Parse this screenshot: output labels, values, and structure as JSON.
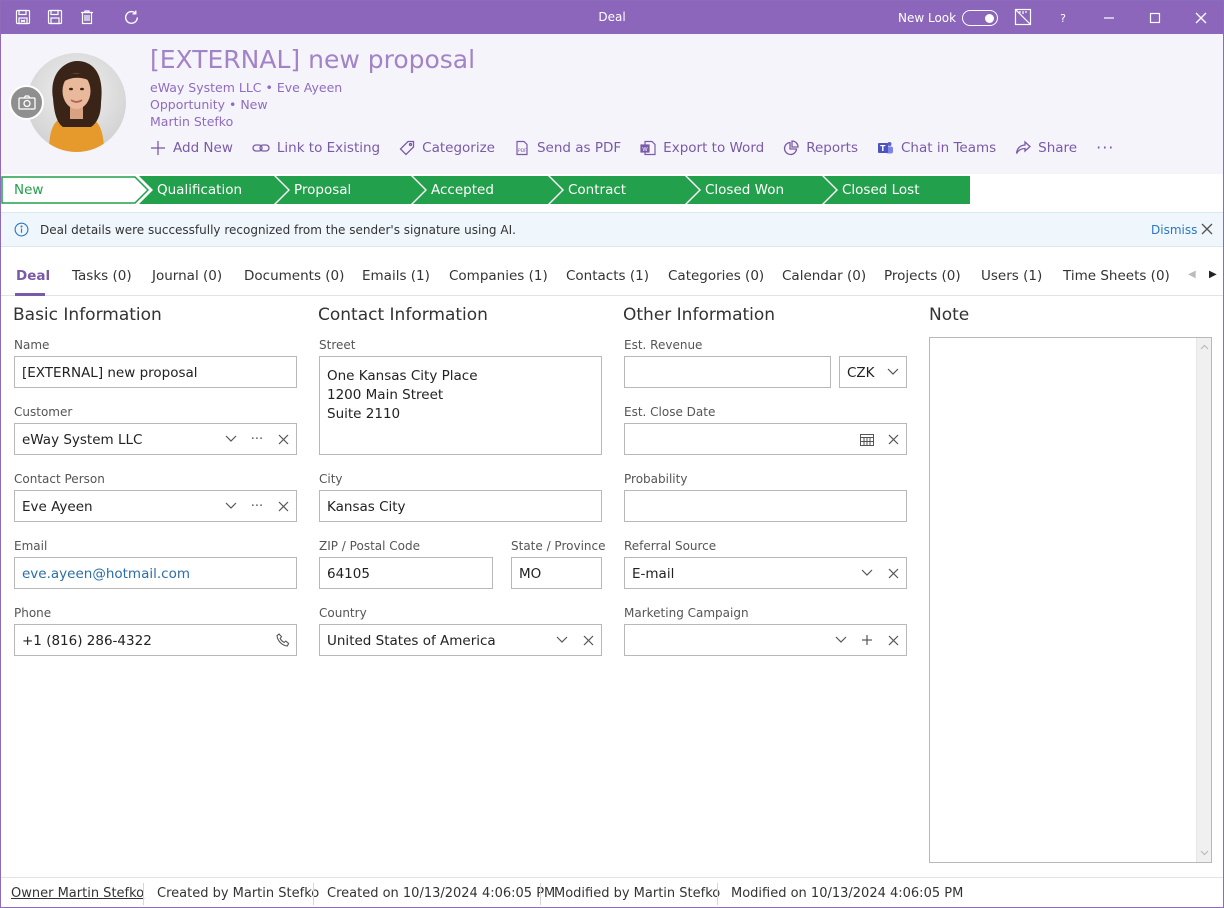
{
  "window": {
    "title": "Deal",
    "new_look_label": "New Look",
    "help_label": "?"
  },
  "header": {
    "title": "[EXTERNAL] new proposal",
    "line1": "eWay System LLC • Eve Ayeen",
    "line2": "Opportunity • New",
    "line3": "Martin Stefko",
    "actions": {
      "add_new": "Add New",
      "link_existing": "Link to Existing",
      "categorize": "Categorize",
      "send_pdf": "Send as PDF",
      "export_word": "Export to Word",
      "reports": "Reports",
      "chat_teams": "Chat in Teams",
      "share": "Share",
      "more": "···"
    }
  },
  "stages": [
    "New",
    "Qualification",
    "Proposal",
    "Accepted",
    "Contract",
    "Closed Won",
    "Closed Lost"
  ],
  "stage_current": "New",
  "colors": {
    "accent": "#8b66ba",
    "stage_green": "#22a04b",
    "link": "#2b78c2"
  },
  "info": {
    "text": "Deal details were successfully recognized from the sender's signature using AI.",
    "dismiss": "Dismiss"
  },
  "tabs": [
    "Deal",
    "Tasks (0)",
    "Journal (0)",
    "Documents (0)",
    "Emails (1)",
    "Companies (1)",
    "Contacts (1)",
    "Categories (0)",
    "Calendar (0)",
    "Projects (0)",
    "Users (1)",
    "Time Sheets (0)"
  ],
  "basic": {
    "title": "Basic Information",
    "name_label": "Name",
    "name_value": "[EXTERNAL] new proposal",
    "customer_label": "Customer",
    "customer_value": "eWay System LLC",
    "contact_label": "Contact Person",
    "contact_value": "Eve Ayeen",
    "email_label": "Email",
    "email_value": "eve.ayeen@hotmail.com",
    "phone_label": "Phone",
    "phone_value": "+1 (816) 286-4322"
  },
  "contact": {
    "title": "Contact Information",
    "street_label": "Street",
    "street_lines": [
      "One Kansas City Place",
      "1200 Main Street",
      "Suite 2110"
    ],
    "city_label": "City",
    "city_value": "Kansas City",
    "zip_label": "ZIP / Postal Code",
    "zip_value": "64105",
    "state_label": "State / Province",
    "state_value": "MO",
    "country_label": "Country",
    "country_value": "United States of America"
  },
  "other": {
    "title": "Other Information",
    "revenue_label": "Est. Revenue",
    "revenue_value": "",
    "currency_value": "CZK",
    "close_date_label": "Est. Close Date",
    "close_date_value": "",
    "probability_label": "Probability",
    "probability_value": "",
    "referral_label": "Referral Source",
    "referral_value": "E-mail",
    "campaign_label": "Marketing Campaign",
    "campaign_value": ""
  },
  "note": {
    "title": "Note",
    "value": ""
  },
  "status": {
    "owner": "Owner Martin Stefko",
    "created_by": "Created by Martin Stefko",
    "created_on": "Created on 10/13/2024 4:06:05 PM",
    "modified_by": "Modified by Martin Stefko",
    "modified_on": "Modified on 10/13/2024 4:06:05 PM"
  }
}
